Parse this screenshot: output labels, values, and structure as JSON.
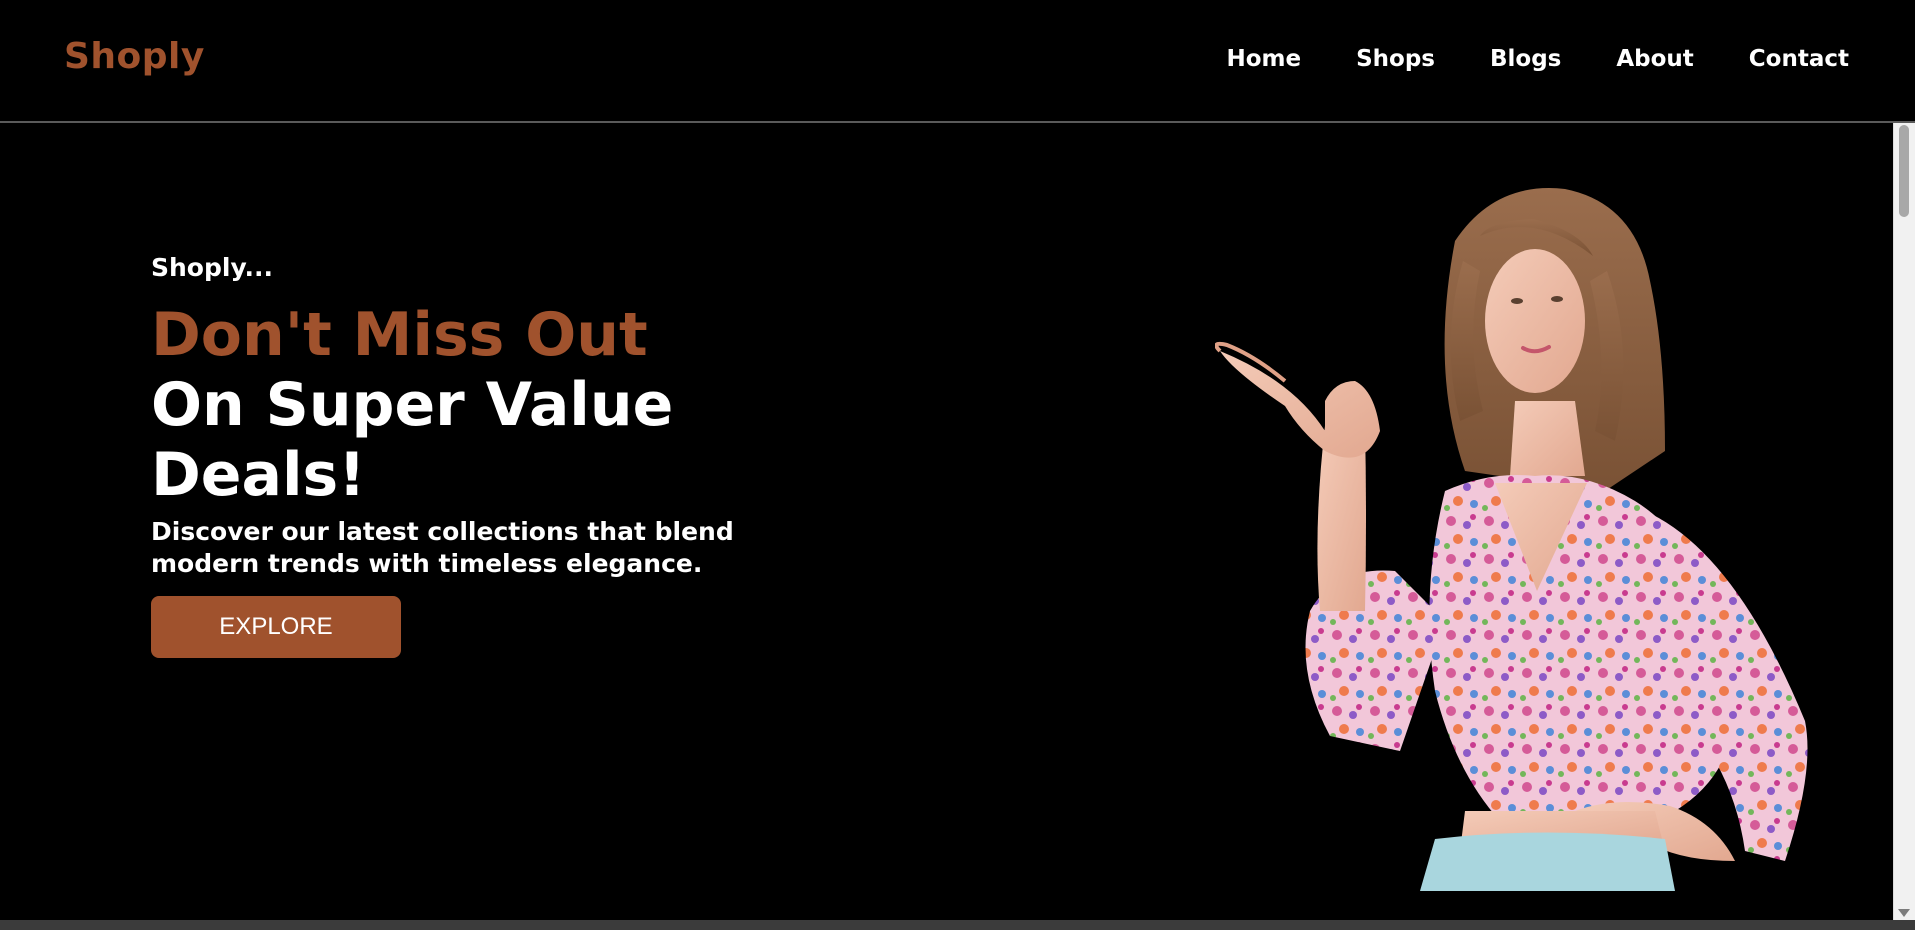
{
  "navbar": {
    "brand": "Shoply",
    "links": [
      "Home",
      "Shops",
      "Blogs",
      "About",
      "Contact"
    ]
  },
  "hero": {
    "eyebrow": "Shoply...",
    "headline_accent": "Don't Miss Out",
    "headline_main": "On Super Value Deals!",
    "description": "Discover our latest collections that blend modern trends with timeless elegance.",
    "cta_label": "EXPLORE"
  },
  "colors": {
    "background": "#000000",
    "accent": "#a0522d",
    "text": "#ffffff"
  }
}
